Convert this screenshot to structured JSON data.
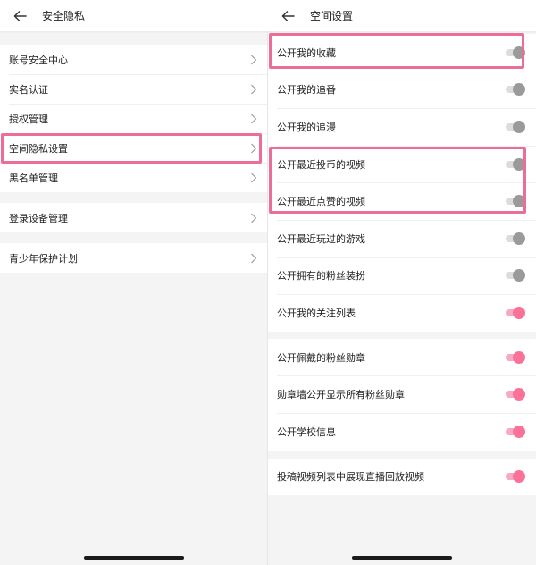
{
  "colors": {
    "accent": "#fb7299",
    "highlight": "#ec6d96",
    "background": "#f4f4f4"
  },
  "left": {
    "title": "安全隐私",
    "back_icon": "arrow-left-icon",
    "groups": [
      {
        "items": [
          "账号安全中心",
          "实名认证",
          "授权管理",
          "空间隐私设置",
          "黑名单管理"
        ]
      },
      {
        "items": [
          "登录设备管理"
        ]
      },
      {
        "items": [
          "青少年保护计划"
        ]
      }
    ],
    "highlighted_item": "空间隐私设置"
  },
  "right": {
    "title": "空间设置",
    "back_icon": "arrow-left-icon",
    "groups": [
      {
        "items": [
          {
            "label": "公开我的收藏",
            "on": false
          },
          {
            "label": "公开我的追番",
            "on": false
          },
          {
            "label": "公开我的追漫",
            "on": false
          },
          {
            "label": "公开最近投币的视频",
            "on": false
          },
          {
            "label": "公开最近点赞的视频",
            "on": false
          },
          {
            "label": "公开最近玩过的游戏",
            "on": false
          },
          {
            "label": "公开拥有的粉丝装扮",
            "on": false
          },
          {
            "label": "公开我的关注列表",
            "on": true
          }
        ]
      },
      {
        "items": [
          {
            "label": "公开佩戴的粉丝勋章",
            "on": true
          },
          {
            "label": "勋章墙公开显示所有粉丝勋章",
            "on": true
          },
          {
            "label": "公开学校信息",
            "on": true
          }
        ]
      },
      {
        "items": [
          {
            "label": "投稿视频列表中展现直播回放视频",
            "on": true
          }
        ]
      }
    ],
    "highlighted_items": [
      "公开我的收藏",
      "公开最近投币的视频",
      "公开最近点赞的视频"
    ]
  }
}
